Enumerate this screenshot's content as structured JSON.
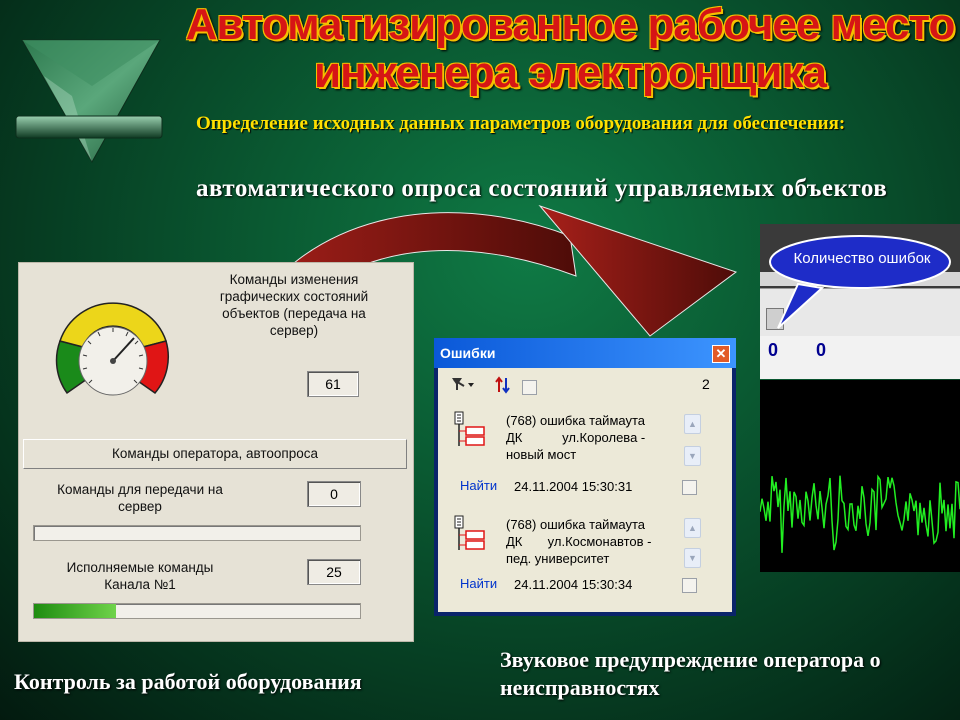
{
  "title": {
    "line1": "Автоматизированное рабочее место",
    "line2": "инженера электронщика"
  },
  "subtitle": {
    "line1": "Определение исходных данных  параметров оборудования для обеспечения:",
    "line2": "автоматического опроса состояний управляемых объектов"
  },
  "left_panel": {
    "commands_graphic_label": "Команды изменения графических состояний объектов (передача на сервер)",
    "commands_graphic_value": "61",
    "operator_group_label": "Команды оператора, автоопроса",
    "send_label": "Команды для передачи на сервер",
    "send_value": "0",
    "executing_label": "Исполняемые команды Канала №1",
    "executing_value": "25",
    "gauge_value_fraction": 0.62,
    "progress_fraction": 0.25,
    "caption": "Контроль за работой оборудования"
  },
  "errors_window": {
    "title": "Ошибки",
    "close_icon": "✕",
    "count": "2",
    "items": [
      {
        "line1": "(768) ошибка таймаута",
        "line2": "ДК           ул.Королева -",
        "line3": "новый мост",
        "find": "Найти",
        "timestamp": "24.11.2004 15:30:31"
      },
      {
        "line1": "(768) ошибка таймаута",
        "line2": "ДК       ул.Космонавтов -",
        "line3": "пед. университет",
        "find": "Найти",
        "timestamp": "24.11.2004 15:30:34"
      }
    ],
    "caption": "Звуковое предупреждение оператора о неисправностях"
  },
  "right_panel": {
    "bubble_label": "Количество ошибок",
    "value1": "0",
    "value2": "0"
  },
  "colors": {
    "title_red": "#d61515",
    "title_outline": "#f5c000",
    "subtitle_yellow": "#ffe000",
    "wave_green": "#22ee22",
    "bubble_blue": "#1e2cc8",
    "arrow_red": "#7a1510"
  }
}
